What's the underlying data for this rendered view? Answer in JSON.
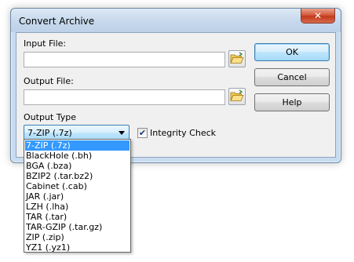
{
  "window": {
    "title": "Convert Archive",
    "close_glyph": "✕"
  },
  "form": {
    "input_label": "Input File:",
    "input_value": "",
    "output_label": "Output File:",
    "output_value": "",
    "output_type_label": "Output Type",
    "selected_type": "7-ZIP (.7z)",
    "integrity_label": "Integrity Check",
    "integrity_checked": true,
    "browse_icon": "folder-open-icon"
  },
  "buttons": {
    "ok": "OK",
    "cancel": "Cancel",
    "help": "Help"
  },
  "dropdown": {
    "options": [
      "7-ZIP (.7z)",
      "BlackHole (.bh)",
      "BGA (.bza)",
      "BZIP2 (.tar.bz2)",
      "Cabinet (.cab)",
      "JAR (.jar)",
      "LZH (.lha)",
      "TAR (.tar)",
      "TAR-GZIP (.tar.gz)",
      "ZIP (.zip)",
      "YZ1 (.yz1)"
    ],
    "highlighted_index": 0
  },
  "colors": {
    "selection": "#3399ff",
    "close_button": "#c2391c"
  }
}
